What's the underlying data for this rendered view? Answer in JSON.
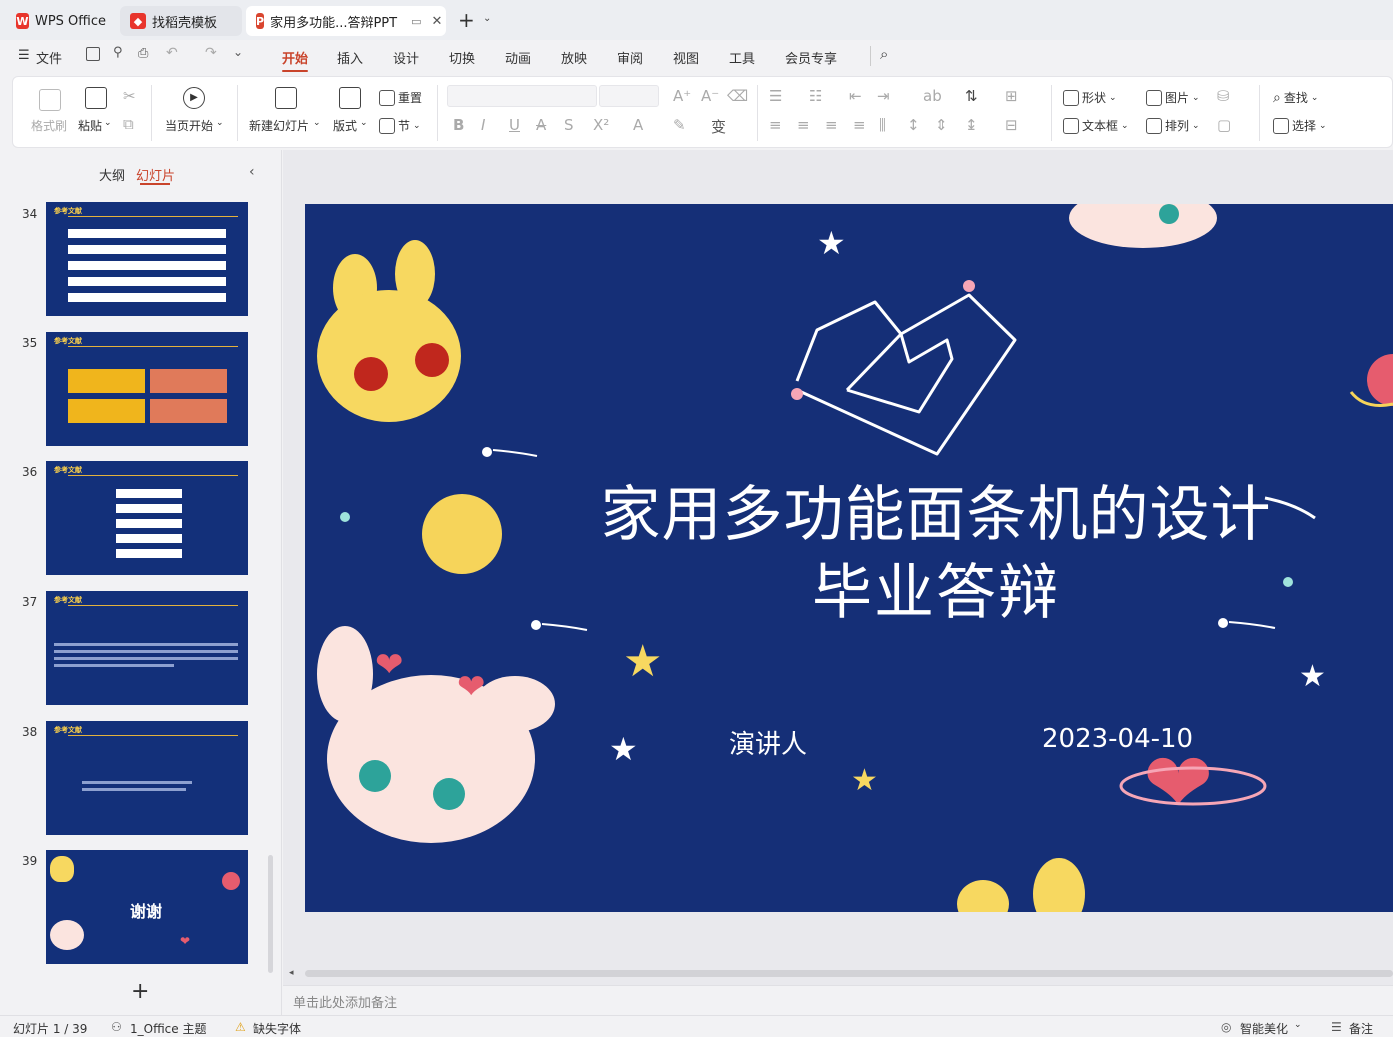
{
  "tabs": [
    {
      "label": "WPS Office",
      "icon": "wps-logo-icon"
    },
    {
      "label": "找稻壳模板",
      "icon": "docer-icon"
    },
    {
      "label": "家用多功能...答辩PPT",
      "icon": "ppt-icon",
      "icon_text": "P"
    }
  ],
  "menu": {
    "file": "文件",
    "items": [
      "开始",
      "插入",
      "设计",
      "切换",
      "动画",
      "放映",
      "审阅",
      "视图",
      "工具",
      "会员专享"
    ],
    "active": "开始"
  },
  "ribbon": {
    "format_painter": "格式刷",
    "paste": "粘贴",
    "start_from_current": "当页开始",
    "new_slide": "新建幻灯片",
    "layout": "版式",
    "reset": "重置",
    "section": "节",
    "shape": "形状",
    "picture": "图片",
    "find": "查找",
    "textbox": "文本框",
    "arrange": "排列",
    "select": "选择"
  },
  "left_panel": {
    "outline_tab": "大纲",
    "slides_tab": "幻灯片",
    "active_tab": "幻灯片",
    "slide_numbers": [
      "34",
      "35",
      "36",
      "37",
      "38",
      "39"
    ],
    "thumb_header": "参考文献",
    "thumb_39_text": "谢谢"
  },
  "slide": {
    "title_line1": "家用多功能面条机的设计",
    "title_line2": "毕业答辩",
    "presenter": "演讲人",
    "date": "2023-04-10",
    "background_color": "#152f77"
  },
  "notes_placeholder": "单击此处添加备注",
  "status": {
    "slide_counter": "幻灯片 1 / 39",
    "theme": "1_Office 主题",
    "missing_font": "缺失字体",
    "smart_beautify": "智能美化",
    "notes": "备注"
  },
  "colors": {
    "accent": "#c9442b",
    "slide_bg": "#152f77"
  }
}
